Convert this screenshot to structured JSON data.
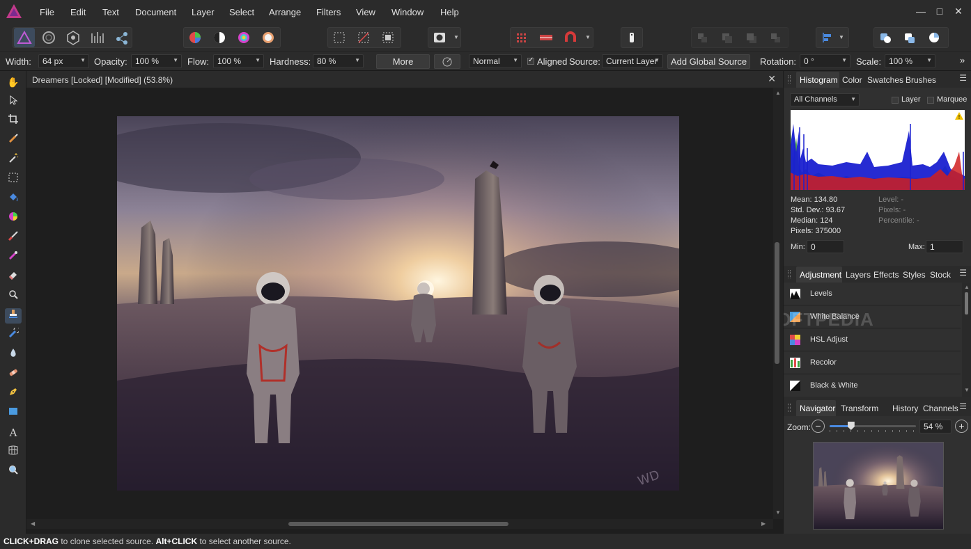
{
  "menu": [
    "File",
    "Edit",
    "Text",
    "Document",
    "Layer",
    "Select",
    "Arrange",
    "Filters",
    "View",
    "Window",
    "Help"
  ],
  "window_controls": {
    "minimize": "—",
    "maximize": "□",
    "close": "✕"
  },
  "context": {
    "width_label": "Width:",
    "width_value": "64 px",
    "opacity_label": "Opacity:",
    "opacity_value": "100 %",
    "flow_label": "Flow:",
    "flow_value": "100 %",
    "hardness_label": "Hardness:",
    "hardness_value": "80 %",
    "more_button": "More",
    "blend_mode": "Normal",
    "aligned_label": "Aligned",
    "source_label": "Source:",
    "source_value": "Current Layer",
    "add_global_source": "Add Global Source",
    "rotation_label": "Rotation:",
    "rotation_value": "0 °",
    "scale_label": "Scale:",
    "scale_value": "100 %",
    "expand": "»"
  },
  "document": {
    "title": "Dreamers [Locked] [Modified] (53.8%)",
    "close": "✕"
  },
  "status": {
    "key1": "CLICK+DRAG",
    "text1": " to clone selected source. ",
    "key2": "Alt+CLICK",
    "text2": " to select another source."
  },
  "histogram": {
    "tabs": [
      "Histogram",
      "Color",
      "Swatches",
      "Brushes"
    ],
    "channel": "All Channels",
    "layer_label": "Layer",
    "marquee_label": "Marquee",
    "warning": "!",
    "mean": "Mean: 134.80",
    "stddev": "Std. Dev.: 93.67",
    "median": "Median: 124",
    "pixels": "Pixels: 375000",
    "level": "Level: -",
    "pixels2": "Pixels: -",
    "percentile": "Percentile: -",
    "min_label": "Min:",
    "min_value": "0",
    "max_label": "Max:",
    "max_value": "1"
  },
  "adjustment": {
    "tabs": [
      "Adjustment",
      "Layers",
      "Effects",
      "Styles",
      "Stock"
    ],
    "items": [
      "Levels",
      "White Balance",
      "HSL Adjust",
      "Recolor",
      "Black & White"
    ],
    "watermark": "SOFTPEDIA"
  },
  "navigator": {
    "tabs": [
      "Navigator",
      "Transform",
      "History",
      "Channels"
    ],
    "zoom_label": "Zoom:",
    "zoom_value": "54 %",
    "zoom_level": 0.54,
    "minus": "−",
    "plus": "+"
  },
  "signature": "WD",
  "colors": {
    "accent": "#3d4b5d",
    "panel": "#2b2b2b",
    "bg": "#1e1e1e"
  }
}
